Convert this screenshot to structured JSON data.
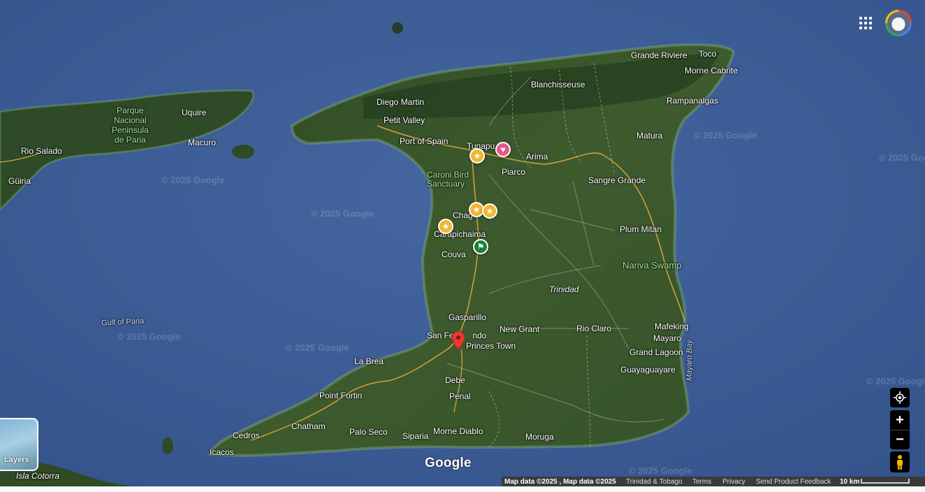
{
  "map": {
    "places": {
      "parque_nacional": "Parque\nNacional\nPeninsula\nde Paria",
      "uquire": "Uquire",
      "macuro": "Macuro",
      "rio_salado": "Rio Salado",
      "guiria": "Güiria",
      "diego_martin": "Diego Martin",
      "petit_valley": "Petit Valley",
      "port_of_spain": "Port of Spain",
      "blanchisseuse": "Blanchisseuse",
      "grande_riviere": "Grande Riviere",
      "toco": "Toco",
      "morne_cabrite": "Morne Cabrite",
      "rampanalgas": "Rampanalgas",
      "matura": "Matura",
      "tunapuna": "Tunapu",
      "arima": "Arima",
      "piarco": "Piarco",
      "caroni": "Caroni Bird\nSanctuary",
      "sangre_grande": "Sangre Grande",
      "chaguanas": "Chag",
      "carapichaima": "Carapichaima",
      "couva": "Couva",
      "plum_mitan": "Plum Mitan",
      "nariva_swamp": "Nariva Swamp",
      "trinidad": "Trinidad",
      "gulf_of_paria": "Gulf of Paria",
      "gasparillo": "Gasparillo",
      "san_fernando": "San Fe        ndo",
      "new_grant": "New Grant",
      "rio_claro": "Rio Claro",
      "mafeking": "Mafeking",
      "mayaro": "Mayaro",
      "princes_town": "Princes Town",
      "grand_lagoon": "Grand Lagoon",
      "la_brea": "La Brea",
      "mayaro_bay": "Mayaro Bay",
      "debe": "Debe",
      "guayaguayare": "Guayaguayare",
      "point_fortin": "Point Fortin",
      "penal": "Penal",
      "chatham": "Chatham",
      "palo_seco": "Palo Seco",
      "siparia": "Siparia",
      "morne_diablo": "Morne Diablo",
      "moruga": "Moruga",
      "cedros": "Cedros",
      "icacos": "Icacos",
      "isla_cotorra": "Isla Cotorra"
    },
    "watermark": "© 2025 Google",
    "brand": "Google"
  },
  "controls": {
    "layers_label": "Layers",
    "zoom_in": "+",
    "zoom_out": "−"
  },
  "footer": {
    "map_data": "Map data ©2025 , Map data ©2025",
    "region": "Trinidad & Tobago",
    "terms": "Terms",
    "privacy": "Privacy",
    "feedback": "Send Product Feedback",
    "scale": "10 km"
  },
  "colors": {
    "sea": "#3f5f9a",
    "land": "#3c5a2c",
    "star_pin": "#f2b634",
    "heart_pin": "#e8578a",
    "flag_pin": "#188038",
    "red_pin": "#e53935"
  }
}
